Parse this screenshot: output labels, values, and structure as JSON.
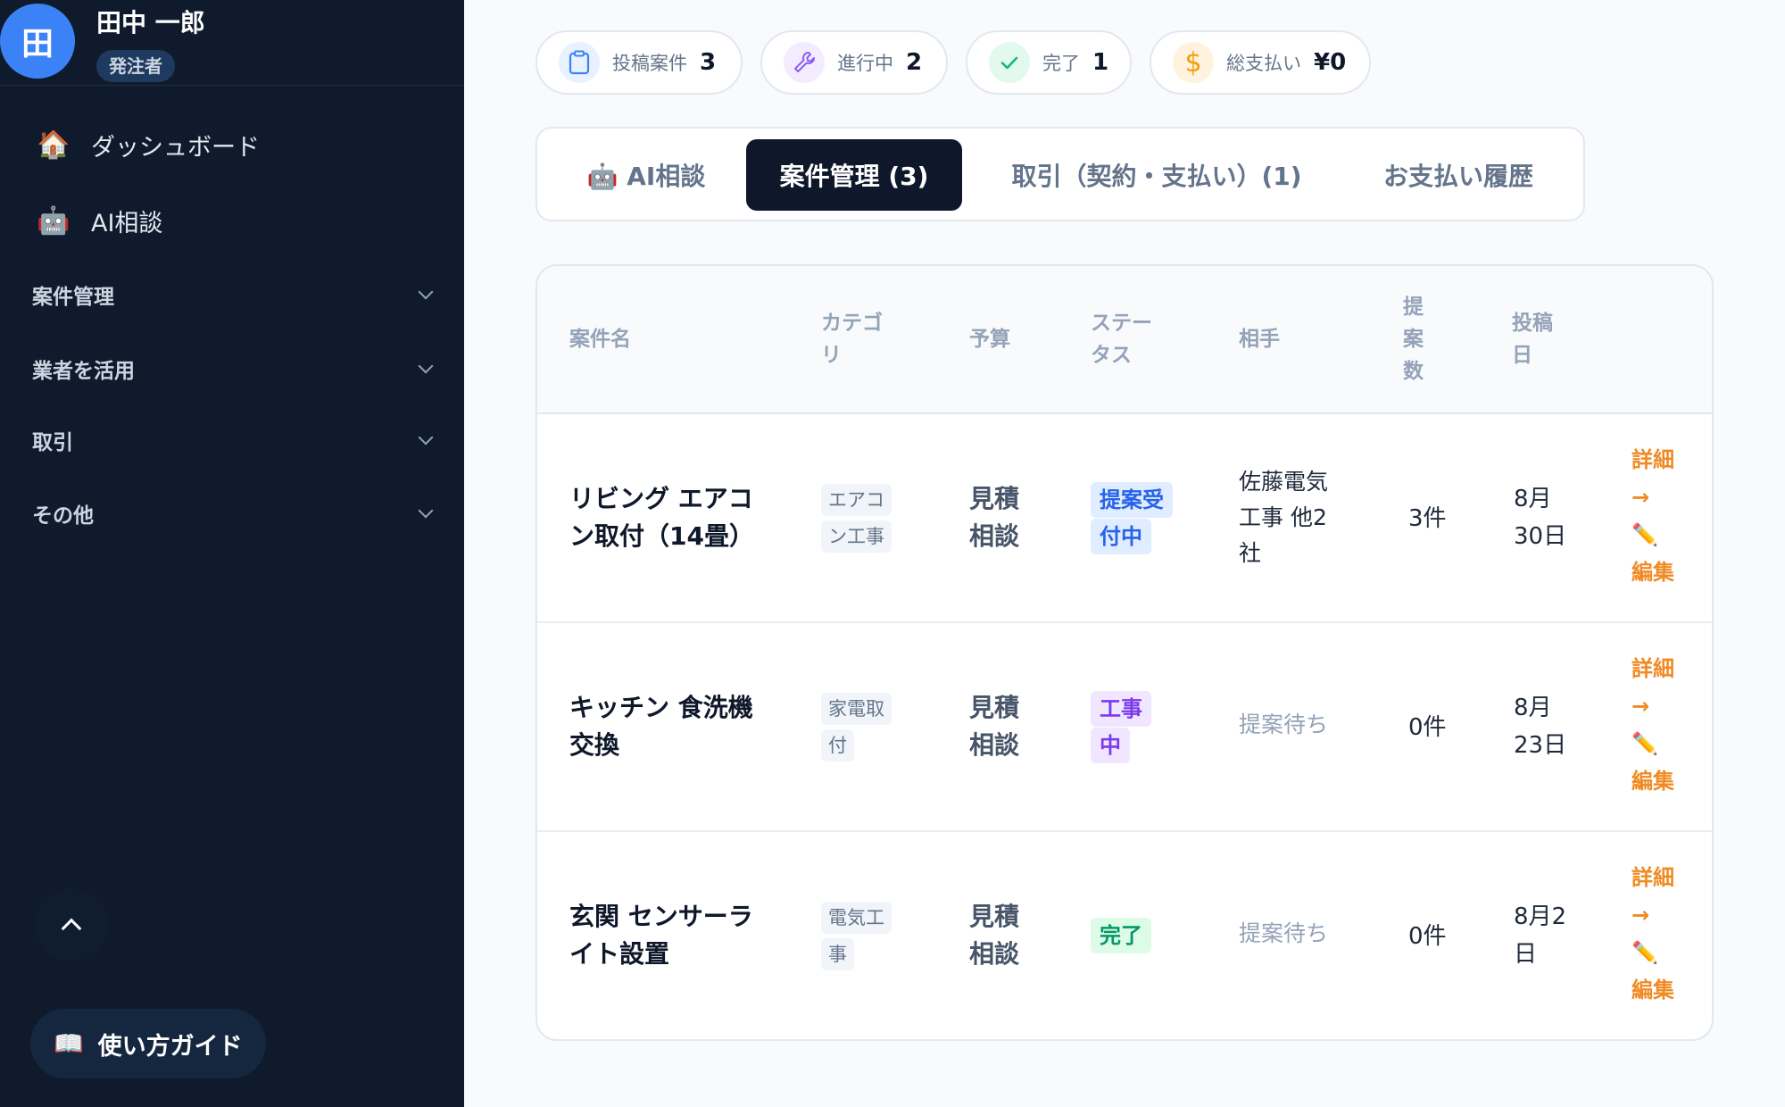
{
  "user": {
    "avatar": "田",
    "name": "田中 一郎",
    "role": "発注者"
  },
  "sidebar": {
    "nav": [
      {
        "icon": "🏠",
        "label": "ダッシュボード"
      },
      {
        "icon": "🤖",
        "label": "AI相談"
      }
    ],
    "sections": [
      {
        "label": "案件管理"
      },
      {
        "label": "業者を活用"
      },
      {
        "label": "取引"
      },
      {
        "label": "その他"
      }
    ],
    "guide": {
      "icon": "📖",
      "label": "使い方ガイド"
    }
  },
  "stats": [
    {
      "label": "投稿案件",
      "value": "3",
      "icon": "clipboard-icon",
      "color": "#3b82f6"
    },
    {
      "label": "進行中",
      "value": "2",
      "icon": "wrench-icon",
      "color": "#8b5cf6"
    },
    {
      "label": "完了",
      "value": "1",
      "icon": "check-icon",
      "color": "#10b981"
    },
    {
      "label": "総支払い",
      "value": "¥0",
      "icon": "dollar-icon",
      "color": "#f59e0b"
    }
  ],
  "tabs": [
    {
      "label": "🤖 AI相談",
      "active": false
    },
    {
      "label": "案件管理 (3)",
      "active": true
    },
    {
      "label": "取引（契約・支払い）(1)",
      "active": false
    },
    {
      "label": "お支払い履歴",
      "active": false
    }
  ],
  "table": {
    "headers": {
      "title": "案件名",
      "category": "カテゴリ",
      "budget": "予算",
      "status": "ステータス",
      "partner": "相手",
      "proposals": "提案数",
      "posted": "投稿日"
    },
    "rows": [
      {
        "title": "リビング エアコン取付（14畳）",
        "category": "エアコン工事",
        "budget": "見積相談",
        "status": "提案受付中",
        "status_color": "#2563eb",
        "status_bg": "#e0ecff",
        "partner": "佐藤電気工事 他2社",
        "partner_muted": false,
        "proposals": "3件",
        "posted": "8月30日",
        "detail": "詳細→",
        "edit": "✏️ 編集"
      },
      {
        "title": "キッチン 食洗機交換",
        "category": "家電取付",
        "budget": "見積相談",
        "status": "工事中",
        "status_color": "#7c3aed",
        "status_bg": "#f0e6ff",
        "partner": "提案待ち",
        "partner_muted": true,
        "proposals": "0件",
        "posted": "8月23日",
        "detail": "詳細→",
        "edit": "✏️ 編集"
      },
      {
        "title": "玄関 センサーライト設置",
        "category": "電気工事",
        "budget": "見積相談",
        "status": "完了",
        "status_color": "#059669",
        "status_bg": "#dcfce7",
        "partner": "提案待ち",
        "partner_muted": true,
        "proposals": "0件",
        "posted": "8月2日",
        "detail": "詳細→",
        "edit": "✏️ 編集"
      }
    ]
  }
}
